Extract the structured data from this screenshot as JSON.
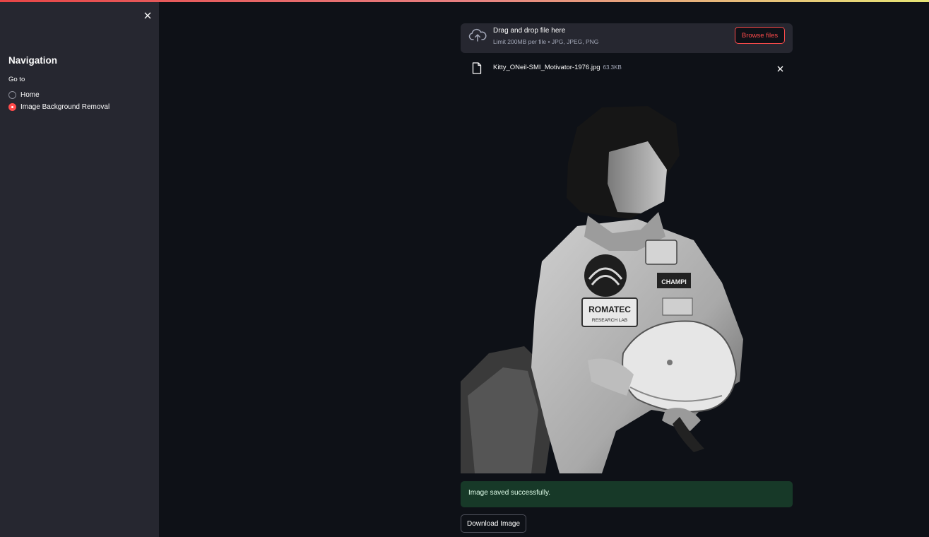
{
  "sidebar": {
    "title": "Navigation",
    "radio_group_label": "Go to",
    "options": [
      {
        "label": "Home",
        "selected": false
      },
      {
        "label": "Image Background Removal",
        "selected": true
      }
    ],
    "close_icon": "close-icon"
  },
  "uploader": {
    "drag_text": "Drag and drop file here",
    "limit_text": "Limit 200MB per file • JPG, JPEG, PNG",
    "browse_label": "Browse files",
    "icon": "cloud-upload-icon"
  },
  "file": {
    "name": "Kitty_ONeil-SMI_Motivator-1976.jpg",
    "size": "63.3KB",
    "icon": "file-icon",
    "remove_icon": "close-icon"
  },
  "result": {
    "patch_text_1": "ROMATEC",
    "patch_text_2": "RESEARCH LAB",
    "patch_text_3": "CHAMPI"
  },
  "status": {
    "message": "Image saved successfully."
  },
  "actions": {
    "download_label": "Download Image"
  },
  "colors": {
    "background": "#0e1117",
    "sidebar": "#262730",
    "accent": "#ff4b4b",
    "success_bg": "#173928"
  }
}
